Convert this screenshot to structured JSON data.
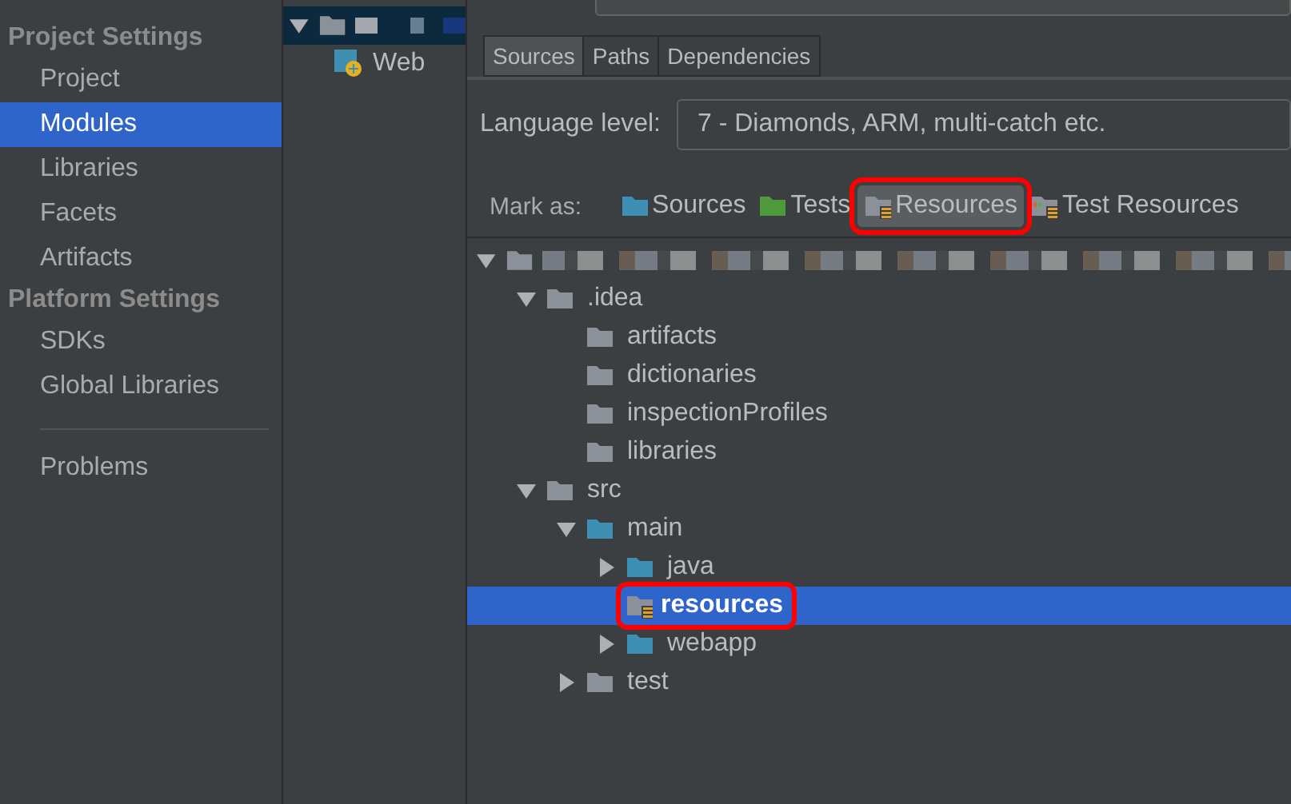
{
  "sidebar": {
    "sections": [
      {
        "title": "Project Settings",
        "items": [
          {
            "label": "Project",
            "selected": false
          },
          {
            "label": "Modules",
            "selected": true
          },
          {
            "label": "Libraries",
            "selected": false
          },
          {
            "label": "Facets",
            "selected": false
          },
          {
            "label": "Artifacts",
            "selected": false
          }
        ]
      },
      {
        "title": "Platform Settings",
        "items": [
          {
            "label": "SDKs",
            "selected": false
          },
          {
            "label": "Global Libraries",
            "selected": false
          }
        ]
      },
      {
        "items": [
          {
            "label": "Problems",
            "selected": false
          }
        ]
      }
    ]
  },
  "module_tree": {
    "items": [
      {
        "kind": "module",
        "expanded": true,
        "selected": true,
        "children": [
          {
            "kind": "web",
            "label": "Web",
            "selected": false
          }
        ]
      }
    ]
  },
  "editor": {
    "tabs": [
      {
        "label": "Sources",
        "selected": true
      },
      {
        "label": "Paths",
        "selected": false
      },
      {
        "label": "Dependencies",
        "selected": false
      }
    ],
    "language_level": {
      "label": "Language level:",
      "value": "7 - Diamonds, ARM, multi-catch etc."
    },
    "mark_as": {
      "label": "Mark as:",
      "buttons": [
        {
          "kind": "sources",
          "label": "Sources",
          "selected": false,
          "annotated": false
        },
        {
          "kind": "tests",
          "label": "Tests",
          "selected": false,
          "annotated": false
        },
        {
          "kind": "resources",
          "label": "Resources",
          "selected": true,
          "annotated": true
        },
        {
          "kind": "test-resources",
          "label": "Test Resources",
          "selected": false,
          "annotated": false
        }
      ]
    },
    "tree": [
      {
        "kind": "plain",
        "expanded": true,
        "selected": false,
        "children": [
          {
            "kind": "plain",
            "label": ".idea",
            "expanded": true,
            "selected": false,
            "annotated": false,
            "children": [
              {
                "kind": "plain",
                "label": "artifacts",
                "selected": false,
                "annotated": false
              },
              {
                "kind": "plain",
                "label": "dictionaries",
                "selected": false,
                "annotated": false
              },
              {
                "kind": "plain",
                "label": "inspectionProfiles",
                "selected": false,
                "annotated": false
              },
              {
                "kind": "plain",
                "label": "libraries",
                "selected": false,
                "annotated": false
              }
            ]
          },
          {
            "kind": "plain",
            "label": "src",
            "expanded": true,
            "selected": false,
            "annotated": false,
            "children": [
              {
                "kind": "source",
                "label": "main",
                "expanded": true,
                "selected": false,
                "annotated": false,
                "children": [
                  {
                    "kind": "source",
                    "label": "java",
                    "expanded": false,
                    "selected": false,
                    "annotated": false
                  },
                  {
                    "kind": "resource",
                    "label": "resources",
                    "selected": true,
                    "annotated": true
                  },
                  {
                    "kind": "source",
                    "label": "webapp",
                    "expanded": false,
                    "selected": false,
                    "annotated": false
                  }
                ]
              },
              {
                "kind": "plain",
                "label": "test",
                "expanded": false,
                "selected": false,
                "annotated": false
              }
            ]
          }
        ]
      }
    ]
  }
}
